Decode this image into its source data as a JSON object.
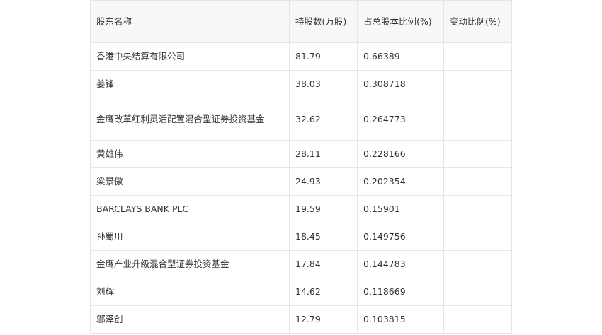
{
  "table": {
    "headers": [
      "股东名称",
      "持股数(万股)",
      "占总股本比例(%)",
      "变动比例(%)"
    ],
    "rows": [
      {
        "name": "香港中央结算有限公司",
        "shares": "81.79",
        "ratio": "0.66389",
        "change": ""
      },
      {
        "name": "姜锋",
        "shares": "38.03",
        "ratio": "0.308718",
        "change": ""
      },
      {
        "name": "金鹰改革红利灵活配置混合型证券投资基金",
        "shares": "32.62",
        "ratio": "0.264773",
        "change": ""
      },
      {
        "name": "黄雄伟",
        "shares": "28.11",
        "ratio": "0.228166",
        "change": ""
      },
      {
        "name": "梁景傲",
        "shares": "24.93",
        "ratio": "0.202354",
        "change": ""
      },
      {
        "name": "BARCLAYS BANK PLC",
        "shares": "19.59",
        "ratio": "0.15901",
        "change": ""
      },
      {
        "name": "孙蜀川",
        "shares": "18.45",
        "ratio": "0.149756",
        "change": ""
      },
      {
        "name": "金鹰产业升级混合型证券投资基金",
        "shares": "17.84",
        "ratio": "0.144783",
        "change": ""
      },
      {
        "name": "刘辉",
        "shares": "14.62",
        "ratio": "0.118669",
        "change": ""
      },
      {
        "name": "邬泽创",
        "shares": "12.79",
        "ratio": "0.103815",
        "change": ""
      }
    ]
  }
}
